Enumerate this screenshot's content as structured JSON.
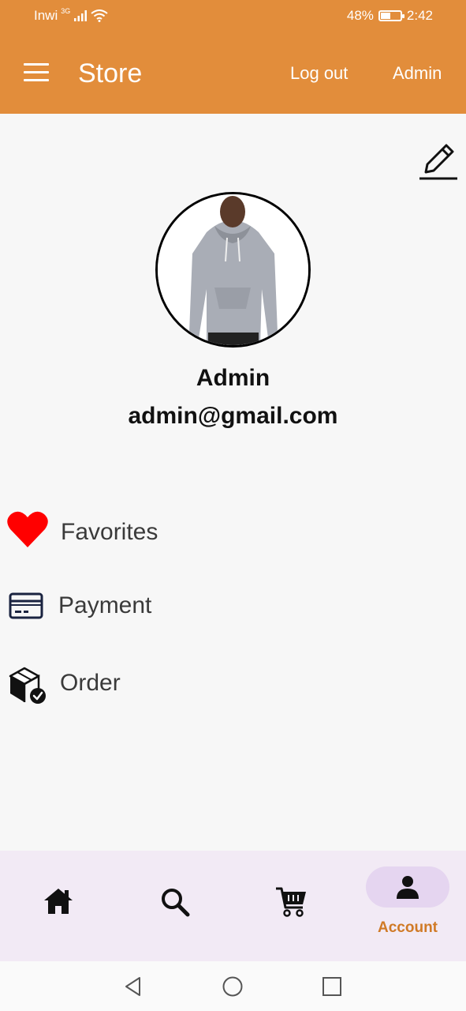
{
  "status_bar": {
    "carrier": "Inwi",
    "network": "3G",
    "battery": "48%",
    "battery_level": 0.48,
    "time": "2:42"
  },
  "app_bar": {
    "title": "Store",
    "logout_label": "Log out",
    "admin_label": "Admin"
  },
  "profile": {
    "name": "Admin",
    "email": "admin@gmail.com"
  },
  "menu": [
    {
      "label": "Favorites",
      "icon": "heart-icon"
    },
    {
      "label": "Payment",
      "icon": "credit-card-icon"
    },
    {
      "label": "Order",
      "icon": "package-check-icon"
    }
  ],
  "bottom_nav": {
    "items": [
      "home-icon",
      "search-icon",
      "cart-icon",
      "account-icon"
    ],
    "account_label": "Account",
    "active": "Account"
  },
  "colors": {
    "accent": "#e28d3b",
    "active_label": "#d07a26",
    "active_pill": "#e5d5f0",
    "nav_bg": "#f2eaf5",
    "favorite": "#ff0000"
  }
}
